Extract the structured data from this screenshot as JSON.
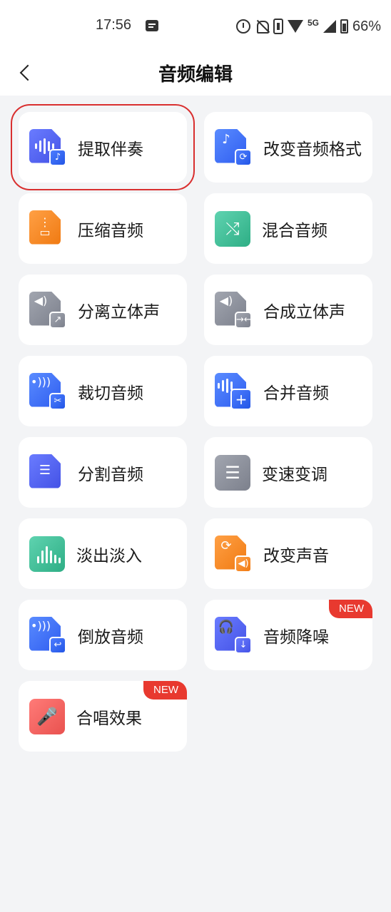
{
  "status": {
    "time": "17:56",
    "network": "5G",
    "battery": "66%"
  },
  "header": {
    "title": "音频编辑"
  },
  "tools": [
    {
      "label": "提取伴奏",
      "icon": "extract-accompaniment-icon",
      "selected": true
    },
    {
      "label": "改变音频格式",
      "icon": "change-format-icon"
    },
    {
      "label": "压缩音频",
      "icon": "compress-audio-icon"
    },
    {
      "label": "混合音频",
      "icon": "mix-audio-icon"
    },
    {
      "label": "分离立体声",
      "icon": "split-stereo-icon"
    },
    {
      "label": "合成立体声",
      "icon": "merge-stereo-icon"
    },
    {
      "label": "裁切音频",
      "icon": "trim-audio-icon"
    },
    {
      "label": "合并音频",
      "icon": "merge-audio-icon"
    },
    {
      "label": "分割音频",
      "icon": "split-audio-icon"
    },
    {
      "label": "变速变调",
      "icon": "speed-pitch-icon"
    },
    {
      "label": "淡出淡入",
      "icon": "fade-icon"
    },
    {
      "label": "改变声音",
      "icon": "change-voice-icon"
    },
    {
      "label": "倒放音频",
      "icon": "reverse-audio-icon"
    },
    {
      "label": "音频降噪",
      "icon": "noise-reduction-icon",
      "badge": "NEW"
    },
    {
      "label": "合唱效果",
      "icon": "chorus-icon",
      "badge": "NEW"
    }
  ],
  "colors": {
    "selection_outline": "#d92f2f",
    "badge": "#e8392f"
  }
}
